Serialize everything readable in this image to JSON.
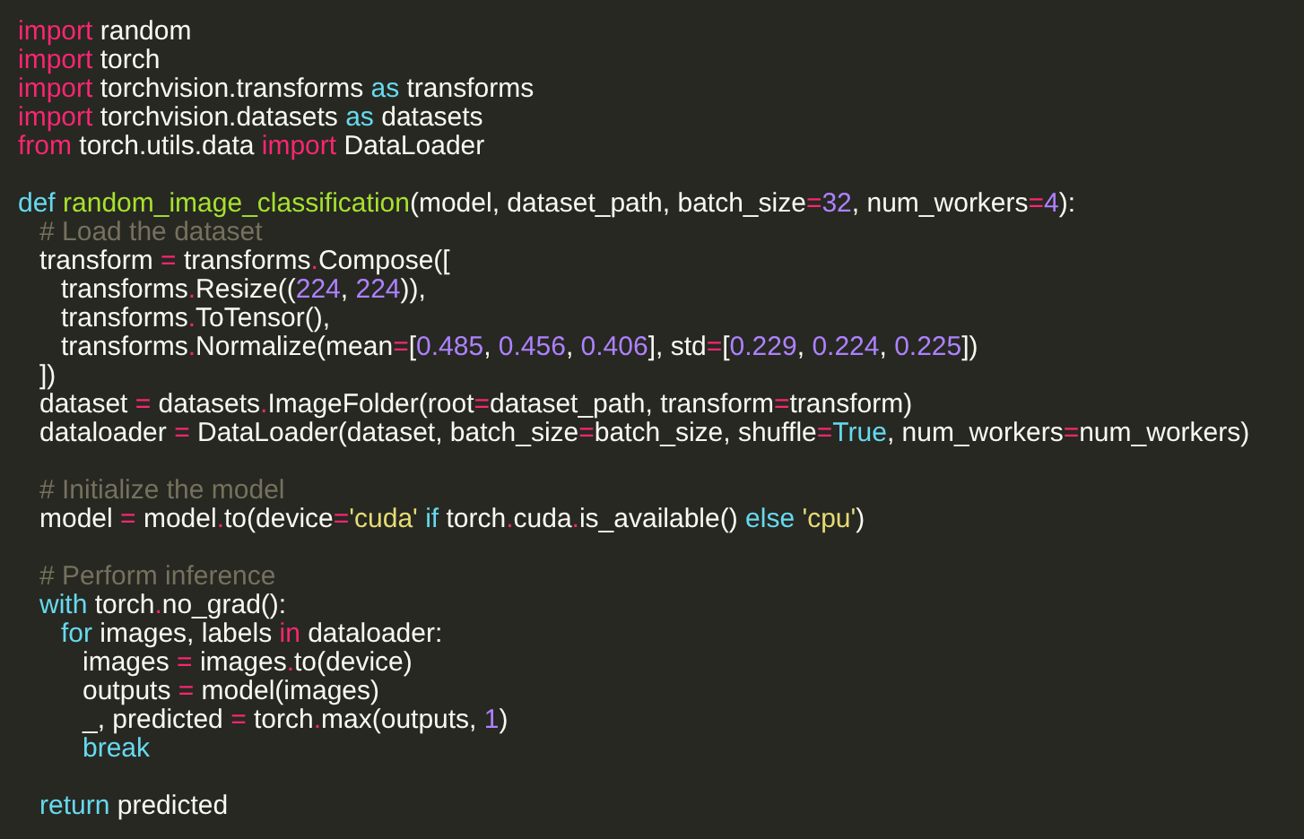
{
  "editor": {
    "lines": [
      {
        "kind": "code",
        "tokens": [
          {
            "kind": "keyword",
            "text": "import"
          },
          {
            "kind": "plain",
            "text": " random"
          }
        ]
      },
      {
        "kind": "code",
        "tokens": [
          {
            "kind": "keyword",
            "text": "import"
          },
          {
            "kind": "plain",
            "text": " torch"
          }
        ]
      },
      {
        "kind": "code",
        "tokens": [
          {
            "kind": "keyword",
            "text": "import"
          },
          {
            "kind": "plain",
            "text": " torchvision.transforms "
          },
          {
            "kind": "builtin",
            "text": "as"
          },
          {
            "kind": "plain",
            "text": " transforms"
          }
        ]
      },
      {
        "kind": "code",
        "tokens": [
          {
            "kind": "keyword",
            "text": "import"
          },
          {
            "kind": "plain",
            "text": " torchvision.datasets "
          },
          {
            "kind": "builtin",
            "text": "as"
          },
          {
            "kind": "plain",
            "text": " datasets"
          }
        ]
      },
      {
        "kind": "code",
        "tokens": [
          {
            "kind": "keyword",
            "text": "from"
          },
          {
            "kind": "plain",
            "text": " torch.utils.data "
          },
          {
            "kind": "keyword",
            "text": "import"
          },
          {
            "kind": "plain",
            "text": " DataLoader"
          }
        ]
      },
      {
        "kind": "blank"
      },
      {
        "kind": "code",
        "tokens": [
          {
            "kind": "builtin",
            "text": "def"
          },
          {
            "kind": "function",
            "text": " random_image_classification"
          },
          {
            "kind": "plain",
            "text": "(model, dataset_path, batch_size"
          },
          {
            "kind": "operator",
            "text": "="
          },
          {
            "kind": "number",
            "text": "32"
          },
          {
            "kind": "plain",
            "text": ", num_workers"
          },
          {
            "kind": "operator",
            "text": "="
          },
          {
            "kind": "number",
            "text": "4"
          },
          {
            "kind": "plain",
            "text": "):"
          }
        ],
        "children": [
          {
            "kind": "code",
            "tokens": [
              {
                "kind": "comment",
                "text": "# Load the dataset"
              }
            ]
          },
          {
            "kind": "code",
            "tokens": [
              {
                "kind": "plain",
                "text": "transform "
              },
              {
                "kind": "operator",
                "text": "="
              },
              {
                "kind": "plain",
                "text": " transforms"
              },
              {
                "kind": "operator",
                "text": "."
              },
              {
                "kind": "plain",
                "text": "Compose(["
              }
            ],
            "children": [
              {
                "kind": "code",
                "tokens": [
                  {
                    "kind": "plain",
                    "text": "transforms"
                  },
                  {
                    "kind": "operator",
                    "text": "."
                  },
                  {
                    "kind": "plain",
                    "text": "Resize(("
                  },
                  {
                    "kind": "number",
                    "text": "224"
                  },
                  {
                    "kind": "plain",
                    "text": ", "
                  },
                  {
                    "kind": "number",
                    "text": "224"
                  },
                  {
                    "kind": "plain",
                    "text": ")),"
                  }
                ]
              },
              {
                "kind": "code",
                "tokens": [
                  {
                    "kind": "plain",
                    "text": "transforms"
                  },
                  {
                    "kind": "operator",
                    "text": "."
                  },
                  {
                    "kind": "plain",
                    "text": "ToTensor(),"
                  }
                ]
              },
              {
                "kind": "code",
                "tokens": [
                  {
                    "kind": "plain",
                    "text": "transforms"
                  },
                  {
                    "kind": "operator",
                    "text": "."
                  },
                  {
                    "kind": "plain",
                    "text": "Normalize(mean"
                  },
                  {
                    "kind": "operator",
                    "text": "="
                  },
                  {
                    "kind": "plain",
                    "text": "["
                  },
                  {
                    "kind": "number",
                    "text": "0.485"
                  },
                  {
                    "kind": "plain",
                    "text": ", "
                  },
                  {
                    "kind": "number",
                    "text": "0.456"
                  },
                  {
                    "kind": "plain",
                    "text": ", "
                  },
                  {
                    "kind": "number",
                    "text": "0.406"
                  },
                  {
                    "kind": "plain",
                    "text": "], std"
                  },
                  {
                    "kind": "operator",
                    "text": "="
                  },
                  {
                    "kind": "plain",
                    "text": "["
                  },
                  {
                    "kind": "number",
                    "text": "0.229"
                  },
                  {
                    "kind": "plain",
                    "text": ", "
                  },
                  {
                    "kind": "number",
                    "text": "0.224"
                  },
                  {
                    "kind": "plain",
                    "text": ", "
                  },
                  {
                    "kind": "number",
                    "text": "0.225"
                  },
                  {
                    "kind": "plain",
                    "text": "])"
                  }
                ]
              }
            ]
          },
          {
            "kind": "code",
            "tokens": [
              {
                "kind": "plain",
                "text": "])"
              }
            ]
          },
          {
            "kind": "code",
            "tokens": [
              {
                "kind": "plain",
                "text": "dataset "
              },
              {
                "kind": "operator",
                "text": "="
              },
              {
                "kind": "plain",
                "text": " datasets"
              },
              {
                "kind": "operator",
                "text": "."
              },
              {
                "kind": "plain",
                "text": "ImageFolder(root"
              },
              {
                "kind": "operator",
                "text": "="
              },
              {
                "kind": "plain",
                "text": "dataset_path, transform"
              },
              {
                "kind": "operator",
                "text": "="
              },
              {
                "kind": "plain",
                "text": "transform)"
              }
            ]
          },
          {
            "kind": "code",
            "tokens": [
              {
                "kind": "plain",
                "text": "dataloader "
              },
              {
                "kind": "operator",
                "text": "="
              },
              {
                "kind": "plain",
                "text": " DataLoader(dataset, batch_size"
              },
              {
                "kind": "operator",
                "text": "="
              },
              {
                "kind": "plain",
                "text": "batch_size, shuffle"
              },
              {
                "kind": "operator",
                "text": "="
              },
              {
                "kind": "builtin",
                "text": "True"
              },
              {
                "kind": "plain",
                "text": ", num_workers"
              },
              {
                "kind": "operator",
                "text": "="
              },
              {
                "kind": "plain",
                "text": "num_workers)"
              }
            ]
          },
          {
            "kind": "blank"
          },
          {
            "kind": "code",
            "tokens": [
              {
                "kind": "comment",
                "text": "# Initialize the model"
              }
            ]
          },
          {
            "kind": "code",
            "tokens": [
              {
                "kind": "plain",
                "text": "model "
              },
              {
                "kind": "operator",
                "text": "="
              },
              {
                "kind": "plain",
                "text": " model"
              },
              {
                "kind": "operator",
                "text": "."
              },
              {
                "kind": "plain",
                "text": "to(device"
              },
              {
                "kind": "operator",
                "text": "="
              },
              {
                "kind": "string",
                "text": "'cuda'"
              },
              {
                "kind": "builtin",
                "text": " if"
              },
              {
                "kind": "plain",
                "text": " torch"
              },
              {
                "kind": "operator",
                "text": "."
              },
              {
                "kind": "plain",
                "text": "cuda"
              },
              {
                "kind": "operator",
                "text": "."
              },
              {
                "kind": "plain",
                "text": "is_available() "
              },
              {
                "kind": "builtin",
                "text": "else"
              },
              {
                "kind": "string",
                "text": " 'cpu'"
              },
              {
                "kind": "plain",
                "text": ")"
              }
            ]
          },
          {
            "kind": "blank"
          },
          {
            "kind": "code",
            "tokens": [
              {
                "kind": "comment",
                "text": "# Perform inference"
              }
            ]
          },
          {
            "kind": "code",
            "tokens": [
              {
                "kind": "builtin",
                "text": "with"
              },
              {
                "kind": "plain",
                "text": " torch"
              },
              {
                "kind": "operator",
                "text": "."
              },
              {
                "kind": "plain",
                "text": "no_grad():"
              }
            ],
            "children": [
              {
                "kind": "code",
                "tokens": [
                  {
                    "kind": "builtin",
                    "text": "for"
                  },
                  {
                    "kind": "plain",
                    "text": " images, labels "
                  },
                  {
                    "kind": "keyword",
                    "text": "in"
                  },
                  {
                    "kind": "plain",
                    "text": " dataloader:"
                  }
                ],
                "children": [
                  {
                    "kind": "code",
                    "tokens": [
                      {
                        "kind": "plain",
                        "text": "images "
                      },
                      {
                        "kind": "operator",
                        "text": "="
                      },
                      {
                        "kind": "plain",
                        "text": " images"
                      },
                      {
                        "kind": "operator",
                        "text": "."
                      },
                      {
                        "kind": "plain",
                        "text": "to(device)"
                      }
                    ]
                  },
                  {
                    "kind": "code",
                    "tokens": [
                      {
                        "kind": "plain",
                        "text": "outputs "
                      },
                      {
                        "kind": "operator",
                        "text": "="
                      },
                      {
                        "kind": "plain",
                        "text": " model(images)"
                      }
                    ]
                  },
                  {
                    "kind": "code",
                    "tokens": [
                      {
                        "kind": "plain",
                        "text": "_, predicted "
                      },
                      {
                        "kind": "operator",
                        "text": "="
                      },
                      {
                        "kind": "plain",
                        "text": " torch"
                      },
                      {
                        "kind": "operator",
                        "text": "."
                      },
                      {
                        "kind": "plain",
                        "text": "max(outputs, "
                      },
                      {
                        "kind": "number",
                        "text": "1"
                      },
                      {
                        "kind": "plain",
                        "text": ")"
                      }
                    ]
                  },
                  {
                    "kind": "code",
                    "tokens": [
                      {
                        "kind": "builtin",
                        "text": "break"
                      }
                    ]
                  }
                ]
              }
            ]
          },
          {
            "kind": "blank"
          },
          {
            "kind": "code",
            "tokens": [
              {
                "kind": "builtin",
                "text": "return"
              },
              {
                "kind": "plain",
                "text": " predicted"
              }
            ]
          }
        ]
      }
    ]
  }
}
